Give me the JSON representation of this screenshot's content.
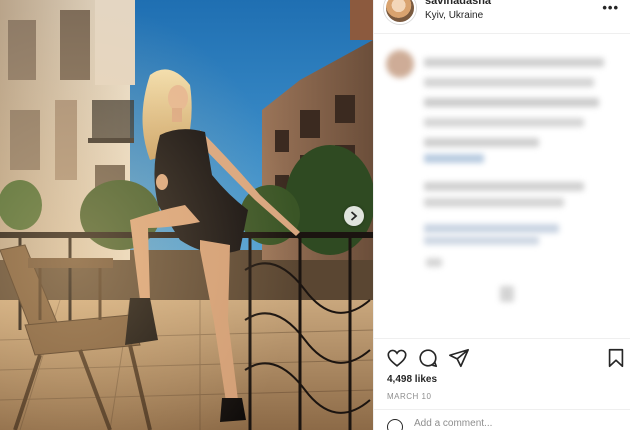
{
  "post": {
    "username": "savinadasha",
    "location": "Kyiv, Ukraine",
    "more_icon": "more-horizontal-icon",
    "likes_text": "4,498 likes",
    "date_text": "MARCH 10"
  },
  "actions": {
    "icons": [
      "heart-icon",
      "comment-icon",
      "share-icon",
      "bookmark-icon"
    ]
  },
  "comment_box": {
    "placeholder": "Add a comment..."
  },
  "colors": {
    "text": "#262626",
    "muted": "#8e8e8e",
    "divider": "#efefef",
    "sky": "#2a76b8"
  }
}
